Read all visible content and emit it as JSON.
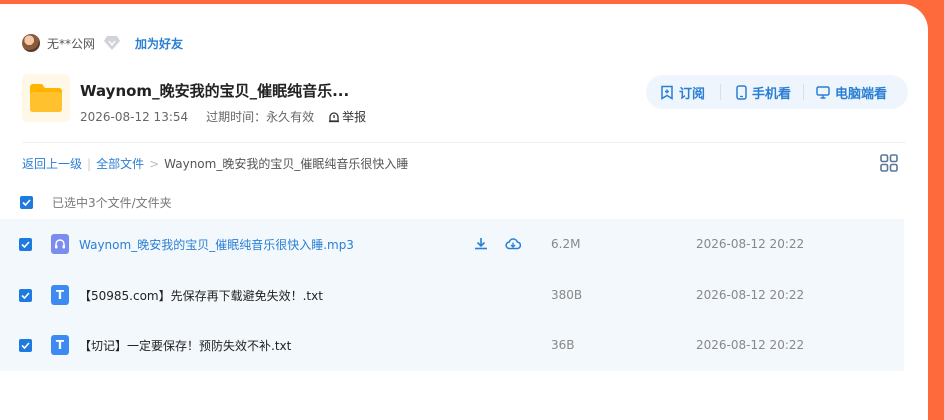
{
  "owner": {
    "username": "无**公网",
    "add_friend": "加为好友"
  },
  "share": {
    "title": "Waynom_晚安我的宝贝_催眠纯音乐...",
    "created": "2026-08-12 13:54",
    "expire_label": "过期时间：永久有效",
    "report": "举报"
  },
  "actions": {
    "subscribe": "订阅",
    "mobile": "手机看",
    "desktop": "电脑端看"
  },
  "breadcrumb": {
    "back": "返回上一级",
    "all_files": "全部文件",
    "separator": ">",
    "current": "Waynom_晚安我的宝贝_催眠纯音乐很快入睡"
  },
  "selection": {
    "text": "已选中3个文件/文件夹"
  },
  "files": [
    {
      "name": "Waynom_晚安我的宝贝_催眠纯音乐很快入睡.mp3",
      "size": "6.2M",
      "date": "2026-08-12 20:22",
      "type": "audio"
    },
    {
      "name": "【50985.com】先保存再下载避免失效！.txt",
      "size": "380B",
      "date": "2026-08-12 20:22",
      "type": "text"
    },
    {
      "name": "【切记】一定要保存！预防失效不补.txt",
      "size": "36B",
      "date": "2026-08-12 20:22",
      "type": "text"
    }
  ],
  "text_icon_letter": "T",
  "colors": {
    "accent": "#2a7fd4",
    "checkbox": "#1f7ae0",
    "brand_bg": "#ff6a3d",
    "folder": "#ffc12e"
  }
}
